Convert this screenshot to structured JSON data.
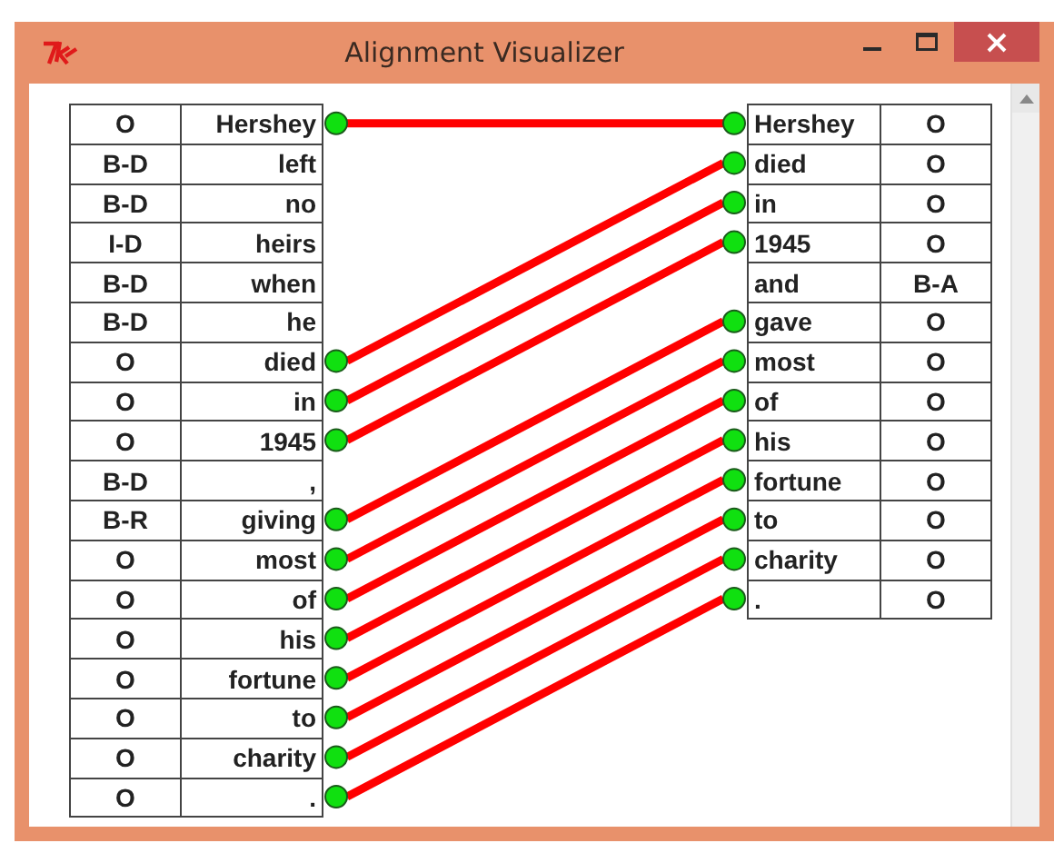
{
  "window": {
    "title": "Alignment Visualizer"
  },
  "source": [
    {
      "tag": "O",
      "word": "Hershey",
      "linked": true
    },
    {
      "tag": "B-D",
      "word": "left",
      "linked": false
    },
    {
      "tag": "B-D",
      "word": "no",
      "linked": false
    },
    {
      "tag": "I-D",
      "word": "heirs",
      "linked": false
    },
    {
      "tag": "B-D",
      "word": "when",
      "linked": false
    },
    {
      "tag": "B-D",
      "word": "he",
      "linked": false
    },
    {
      "tag": "O",
      "word": "died",
      "linked": true
    },
    {
      "tag": "O",
      "word": "in",
      "linked": true
    },
    {
      "tag": "O",
      "word": "1945",
      "linked": true
    },
    {
      "tag": "B-D",
      "word": ",",
      "linked": false
    },
    {
      "tag": "B-R",
      "word": "giving",
      "linked": true
    },
    {
      "tag": "O",
      "word": "most",
      "linked": true
    },
    {
      "tag": "O",
      "word": "of",
      "linked": true
    },
    {
      "tag": "O",
      "word": "his",
      "linked": true
    },
    {
      "tag": "O",
      "word": "fortune",
      "linked": true
    },
    {
      "tag": "O",
      "word": "to",
      "linked": true
    },
    {
      "tag": "O",
      "word": "charity",
      "linked": true
    },
    {
      "tag": "O",
      "word": ".",
      "linked": true
    }
  ],
  "target": [
    {
      "word": "Hershey",
      "tag": "O",
      "linked": true
    },
    {
      "word": "died",
      "tag": "O",
      "linked": true
    },
    {
      "word": "in",
      "tag": "O",
      "linked": true
    },
    {
      "word": "1945",
      "tag": "O",
      "linked": true
    },
    {
      "word": "and",
      "tag": "B-A",
      "linked": false
    },
    {
      "word": "gave",
      "tag": "O",
      "linked": true
    },
    {
      "word": "most",
      "tag": "O",
      "linked": true
    },
    {
      "word": "of",
      "tag": "O",
      "linked": true
    },
    {
      "word": "his",
      "tag": "O",
      "linked": true
    },
    {
      "word": "fortune",
      "tag": "O",
      "linked": true
    },
    {
      "word": "to",
      "tag": "O",
      "linked": true
    },
    {
      "word": "charity",
      "tag": "O",
      "linked": true
    },
    {
      "word": ".",
      "tag": "O",
      "linked": true
    }
  ]
}
